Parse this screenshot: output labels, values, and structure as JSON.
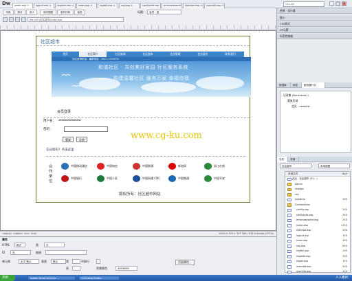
{
  "app": {
    "logo": "Dw"
  },
  "doc_tabs": [
    "index.asp ×",
    "logout.asp ×",
    "register.asp ×",
    "news.asp ×",
    "regfail.asp ×",
    "reg.asp ×",
    "configinfo.asp ×",
    "errorpassword.asp ×",
    "listnews.asp ×",
    "useredit.asp ×"
  ],
  "search_placeholder": "CS Live",
  "window_controls": [
    "_",
    "□",
    "×"
  ],
  "toolbar": {
    "view_buttons": [
      "代码",
      "拆分",
      "设计",
      "实时视图",
      "实时代码",
      "检查"
    ],
    "title_label": "标题:",
    "title_value": "会员 - 首",
    "address": "file:///D:/社区超市/index.asp"
  },
  "page": {
    "site_title": "社区超市",
    "nav": [
      "首页",
      "社区简介",
      "社区新闻",
      "社区超市",
      "会员管理",
      "会员留言",
      "联系我们"
    ],
    "banner_bar": "社区咨询电话：最新电话 · 400-11234578",
    "banner_line1": "和谐社区 · 共创美好家园 社区服务系统",
    "banner_line2": "构建温馨社区   服务万家 幸福你我",
    "login_title": "会员登录",
    "user_label": "用户名：",
    "user_value": "xxxxxxxxxxxxxxx",
    "pass_label": "密码：",
    "login_button": "登录",
    "register_button": "注册",
    "forgot_link": "忘记密码？点击这里",
    "partner_label": "合作单位",
    "partners": [
      "中国移动通信",
      "中国电信",
      "中国联通",
      "新浪网",
      "浙江在线",
      "中国银行",
      "中国人寿",
      "中国网通 CNC",
      "中国铁通",
      "中国平安"
    ],
    "footer": "版权所有：社区超市网站"
  },
  "watermark": "www.cg-ku.com",
  "statusbar": {
    "left": "<body> <table> <tr> <td>",
    "right": "100%  ▾  709 × 343  39K / 6 秒  Unicode (UTF-8)"
  },
  "properties": {
    "title": "属性",
    "fields": [
      {
        "label": "HTML",
        "value": "格式"
      },
      {
        "label": "类",
        "value": "无"
      },
      {
        "label": "ID",
        "value": "无"
      },
      {
        "label": "链接",
        "value": ""
      },
      {
        "label": "单元格",
        "value": "水平 默认"
      },
      {
        "label": "垂直",
        "value": "默认"
      },
      {
        "label": "宽",
        "value": ""
      },
      {
        "label": "高",
        "value": ""
      },
      {
        "label": "不换行",
        "value": ""
      },
      {
        "label": "背景颜色",
        "value": "#E6E6E6"
      },
      {
        "label": "页面属性...",
        "value": ""
      }
    ]
  },
  "right_panel": {
    "workspace": "经典 · 设计器",
    "panels": [
      "插入",
      "CSS样式",
      "AP元素",
      "标签检查器"
    ],
    "bindings_tabs": [
      "数据库",
      "绑定",
      "服务器行为"
    ],
    "server_items": [
      "记录集 (Recordset1)",
      "重复区域",
      "会员 - newslist"
    ],
    "files_tabs": [
      "文件",
      "资源"
    ],
    "files_site": "社区超市",
    "files_view": "本地视图",
    "file_columns": [
      "本地文件",
      "大小"
    ],
    "files": [
      {
        "name": "站点 - 社区超市 (D:\\...)",
        "size": ""
      },
      {
        "name": "admin",
        "size": ""
      },
      {
        "name": "images",
        "size": ""
      },
      {
        "name": "css",
        "size": ""
      },
      {
        "name": "jscode.js",
        "size": "4KB"
      },
      {
        "name": "Connections",
        "size": ""
      },
      {
        "name": "config.asp",
        "size": "2KB"
      },
      {
        "name": "configinfo.asp",
        "size": "3KB"
      },
      {
        "name": "errorpassword.asp",
        "size": "2KB"
      },
      {
        "name": "index.asp",
        "size": "12KB"
      },
      {
        "name": "listnews.asp",
        "size": "5KB"
      },
      {
        "name": "logout.asp",
        "size": "1KB"
      },
      {
        "name": "news.asp",
        "size": "4KB"
      },
      {
        "name": "reg.asp",
        "size": "6KB"
      },
      {
        "name": "regfail.asp",
        "size": "1KB"
      },
      {
        "name": "register.asp",
        "size": "3KB"
      },
      {
        "name": "regok.asp",
        "size": "1KB"
      },
      {
        "name": "useredit.asp",
        "size": "5KB"
      },
      {
        "name": "userinfo.asp",
        "size": "4KB"
      }
    ]
  },
  "taskbar": {
    "start": "开始",
    "tasks": [
      "Adobe Dreamweaver...",
      "Camtasia Studio"
    ],
    "clock": "人人素材"
  },
  "colors": {
    "nav": "#3b83c8",
    "page_border": "#5d7a2d",
    "watermark": "#e6c400",
    "taskbar": "#2456a4"
  }
}
